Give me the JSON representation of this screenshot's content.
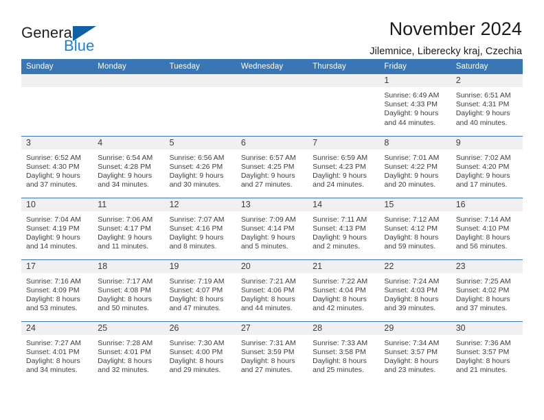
{
  "brand": {
    "name_part1": "General",
    "name_part2": "Blue",
    "flag_icon": "blue-flag-icon",
    "accent_color": "#1b7fd4",
    "text_color": "#231f20"
  },
  "header": {
    "title": "November 2024",
    "subtitle": "Jilemnice, Liberecky kraj, Czechia"
  },
  "theme": {
    "header_blue": "#3b76b4",
    "daynum_band": "#f0f0f0",
    "body_text": "#3d3d3d"
  },
  "calendar": {
    "weekday_headers": [
      "Sunday",
      "Monday",
      "Tuesday",
      "Wednesday",
      "Thursday",
      "Friday",
      "Saturday"
    ],
    "weeks": [
      [
        {
          "day": "",
          "details": ""
        },
        {
          "day": "",
          "details": ""
        },
        {
          "day": "",
          "details": ""
        },
        {
          "day": "",
          "details": ""
        },
        {
          "day": "",
          "details": ""
        },
        {
          "day": "1",
          "details": "Sunrise: 6:49 AM\nSunset: 4:33 PM\nDaylight: 9 hours\nand 44 minutes."
        },
        {
          "day": "2",
          "details": "Sunrise: 6:51 AM\nSunset: 4:31 PM\nDaylight: 9 hours\nand 40 minutes."
        }
      ],
      [
        {
          "day": "3",
          "details": "Sunrise: 6:52 AM\nSunset: 4:30 PM\nDaylight: 9 hours\nand 37 minutes."
        },
        {
          "day": "4",
          "details": "Sunrise: 6:54 AM\nSunset: 4:28 PM\nDaylight: 9 hours\nand 34 minutes."
        },
        {
          "day": "5",
          "details": "Sunrise: 6:56 AM\nSunset: 4:26 PM\nDaylight: 9 hours\nand 30 minutes."
        },
        {
          "day": "6",
          "details": "Sunrise: 6:57 AM\nSunset: 4:25 PM\nDaylight: 9 hours\nand 27 minutes."
        },
        {
          "day": "7",
          "details": "Sunrise: 6:59 AM\nSunset: 4:23 PM\nDaylight: 9 hours\nand 24 minutes."
        },
        {
          "day": "8",
          "details": "Sunrise: 7:01 AM\nSunset: 4:22 PM\nDaylight: 9 hours\nand 20 minutes."
        },
        {
          "day": "9",
          "details": "Sunrise: 7:02 AM\nSunset: 4:20 PM\nDaylight: 9 hours\nand 17 minutes."
        }
      ],
      [
        {
          "day": "10",
          "details": "Sunrise: 7:04 AM\nSunset: 4:19 PM\nDaylight: 9 hours\nand 14 minutes."
        },
        {
          "day": "11",
          "details": "Sunrise: 7:06 AM\nSunset: 4:17 PM\nDaylight: 9 hours\nand 11 minutes."
        },
        {
          "day": "12",
          "details": "Sunrise: 7:07 AM\nSunset: 4:16 PM\nDaylight: 9 hours\nand 8 minutes."
        },
        {
          "day": "13",
          "details": "Sunrise: 7:09 AM\nSunset: 4:14 PM\nDaylight: 9 hours\nand 5 minutes."
        },
        {
          "day": "14",
          "details": "Sunrise: 7:11 AM\nSunset: 4:13 PM\nDaylight: 9 hours\nand 2 minutes."
        },
        {
          "day": "15",
          "details": "Sunrise: 7:12 AM\nSunset: 4:12 PM\nDaylight: 8 hours\nand 59 minutes."
        },
        {
          "day": "16",
          "details": "Sunrise: 7:14 AM\nSunset: 4:10 PM\nDaylight: 8 hours\nand 56 minutes."
        }
      ],
      [
        {
          "day": "17",
          "details": "Sunrise: 7:16 AM\nSunset: 4:09 PM\nDaylight: 8 hours\nand 53 minutes."
        },
        {
          "day": "18",
          "details": "Sunrise: 7:17 AM\nSunset: 4:08 PM\nDaylight: 8 hours\nand 50 minutes."
        },
        {
          "day": "19",
          "details": "Sunrise: 7:19 AM\nSunset: 4:07 PM\nDaylight: 8 hours\nand 47 minutes."
        },
        {
          "day": "20",
          "details": "Sunrise: 7:21 AM\nSunset: 4:06 PM\nDaylight: 8 hours\nand 44 minutes."
        },
        {
          "day": "21",
          "details": "Sunrise: 7:22 AM\nSunset: 4:04 PM\nDaylight: 8 hours\nand 42 minutes."
        },
        {
          "day": "22",
          "details": "Sunrise: 7:24 AM\nSunset: 4:03 PM\nDaylight: 8 hours\nand 39 minutes."
        },
        {
          "day": "23",
          "details": "Sunrise: 7:25 AM\nSunset: 4:02 PM\nDaylight: 8 hours\nand 37 minutes."
        }
      ],
      [
        {
          "day": "24",
          "details": "Sunrise: 7:27 AM\nSunset: 4:01 PM\nDaylight: 8 hours\nand 34 minutes."
        },
        {
          "day": "25",
          "details": "Sunrise: 7:28 AM\nSunset: 4:01 PM\nDaylight: 8 hours\nand 32 minutes."
        },
        {
          "day": "26",
          "details": "Sunrise: 7:30 AM\nSunset: 4:00 PM\nDaylight: 8 hours\nand 29 minutes."
        },
        {
          "day": "27",
          "details": "Sunrise: 7:31 AM\nSunset: 3:59 PM\nDaylight: 8 hours\nand 27 minutes."
        },
        {
          "day": "28",
          "details": "Sunrise: 7:33 AM\nSunset: 3:58 PM\nDaylight: 8 hours\nand 25 minutes."
        },
        {
          "day": "29",
          "details": "Sunrise: 7:34 AM\nSunset: 3:57 PM\nDaylight: 8 hours\nand 23 minutes."
        },
        {
          "day": "30",
          "details": "Sunrise: 7:36 AM\nSunset: 3:57 PM\nDaylight: 8 hours\nand 21 minutes."
        }
      ]
    ]
  }
}
